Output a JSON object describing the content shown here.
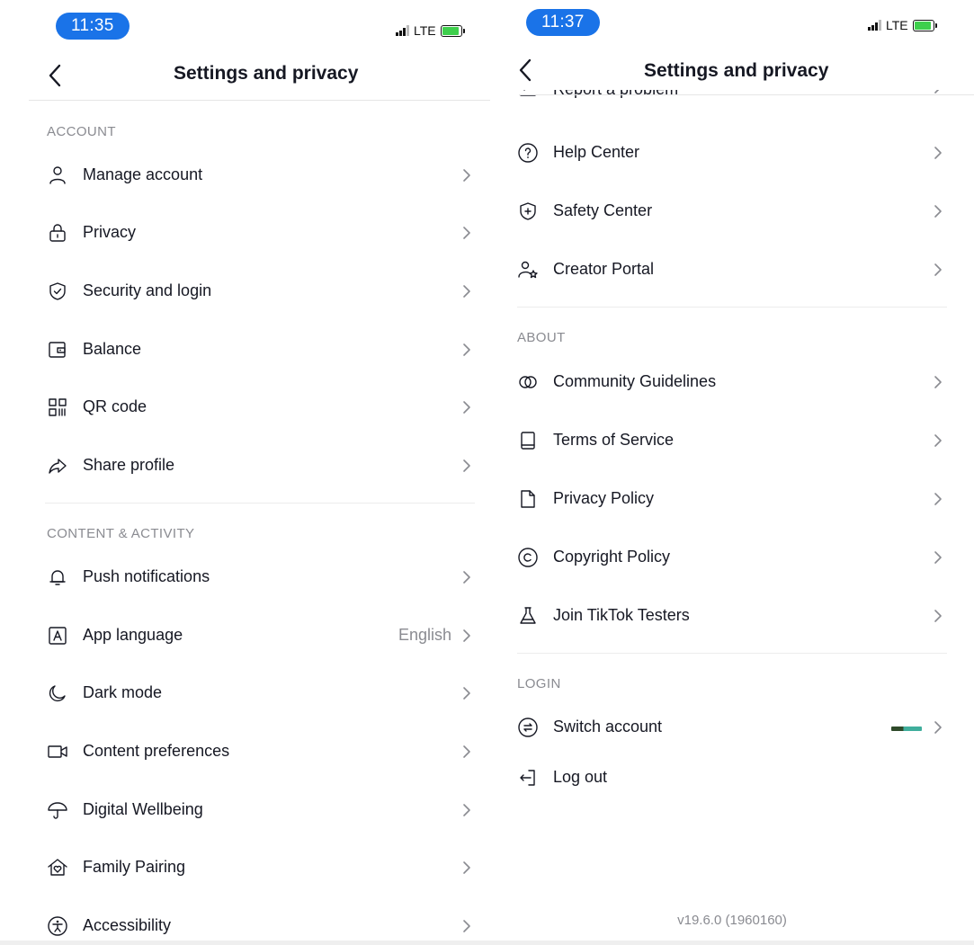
{
  "left_screen": {
    "status": {
      "time": "11:35",
      "network": "LTE"
    },
    "title": "Settings and privacy",
    "sections": [
      {
        "header": "ACCOUNT",
        "items": [
          {
            "label": "Manage account",
            "icon": "person-icon"
          },
          {
            "label": "Privacy",
            "icon": "lock-icon"
          },
          {
            "label": "Security and login",
            "icon": "shield-check-icon"
          },
          {
            "label": "Balance",
            "icon": "wallet-icon"
          },
          {
            "label": "QR code",
            "icon": "qr-code-icon"
          },
          {
            "label": "Share profile",
            "icon": "share-arrow-icon"
          }
        ]
      },
      {
        "header": "CONTENT & ACTIVITY",
        "items": [
          {
            "label": "Push notifications",
            "icon": "bell-icon"
          },
          {
            "label": "App language",
            "icon": "language-a-icon",
            "value": "English"
          },
          {
            "label": "Dark mode",
            "icon": "moon-icon"
          },
          {
            "label": "Content preferences",
            "icon": "video-camera-icon"
          },
          {
            "label": "Digital Wellbeing",
            "icon": "umbrella-icon"
          },
          {
            "label": "Family Pairing",
            "icon": "house-heart-icon"
          },
          {
            "label": "Accessibility",
            "icon": "accessibility-icon"
          }
        ]
      }
    ]
  },
  "right_screen": {
    "status": {
      "time": "11:37",
      "network": "LTE"
    },
    "title": "Settings and privacy",
    "partial_item": {
      "label": "Report a problem",
      "icon": "edit-icon"
    },
    "support_items": [
      {
        "label": "Help Center",
        "icon": "question-circle-icon"
      },
      {
        "label": "Safety Center",
        "icon": "shield-plus-icon"
      },
      {
        "label": "Creator Portal",
        "icon": "person-star-icon"
      }
    ],
    "about": {
      "header": "ABOUT",
      "items": [
        {
          "label": "Community Guidelines",
          "icon": "rings-icon"
        },
        {
          "label": "Terms of Service",
          "icon": "book-icon"
        },
        {
          "label": "Privacy Policy",
          "icon": "document-icon"
        },
        {
          "label": "Copyright Policy",
          "icon": "copyright-icon"
        },
        {
          "label": "Join TikTok Testers",
          "icon": "flask-icon"
        }
      ]
    },
    "login": {
      "header": "LOGIN",
      "items": [
        {
          "label": "Switch account",
          "icon": "swap-circle-icon"
        },
        {
          "label": "Log out",
          "icon": "logout-icon"
        }
      ]
    },
    "version": "v19.6.0 (1960160)"
  }
}
